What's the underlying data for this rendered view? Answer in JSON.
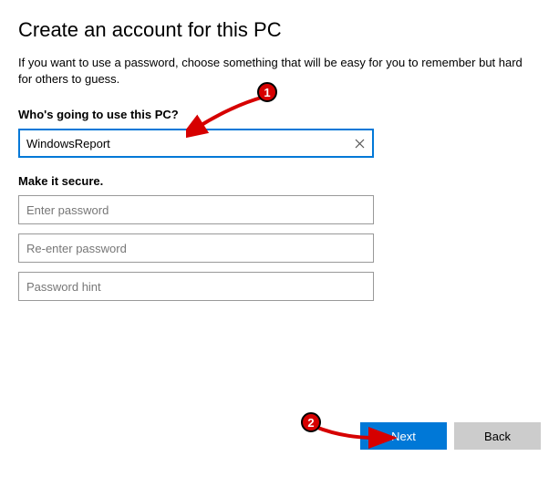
{
  "title": "Create an account for this PC",
  "description": "If you want to use a password, choose something that will be easy for you to remember but hard for others to guess.",
  "username_section": {
    "label": "Who's going to use this PC?",
    "value": "WindowsReport"
  },
  "password_section": {
    "label": "Make it secure.",
    "password_placeholder": "Enter password",
    "confirm_placeholder": "Re-enter password",
    "hint_placeholder": "Password hint"
  },
  "buttons": {
    "next": "Next",
    "back": "Back"
  },
  "annotations": {
    "badge1": "1",
    "badge2": "2"
  }
}
